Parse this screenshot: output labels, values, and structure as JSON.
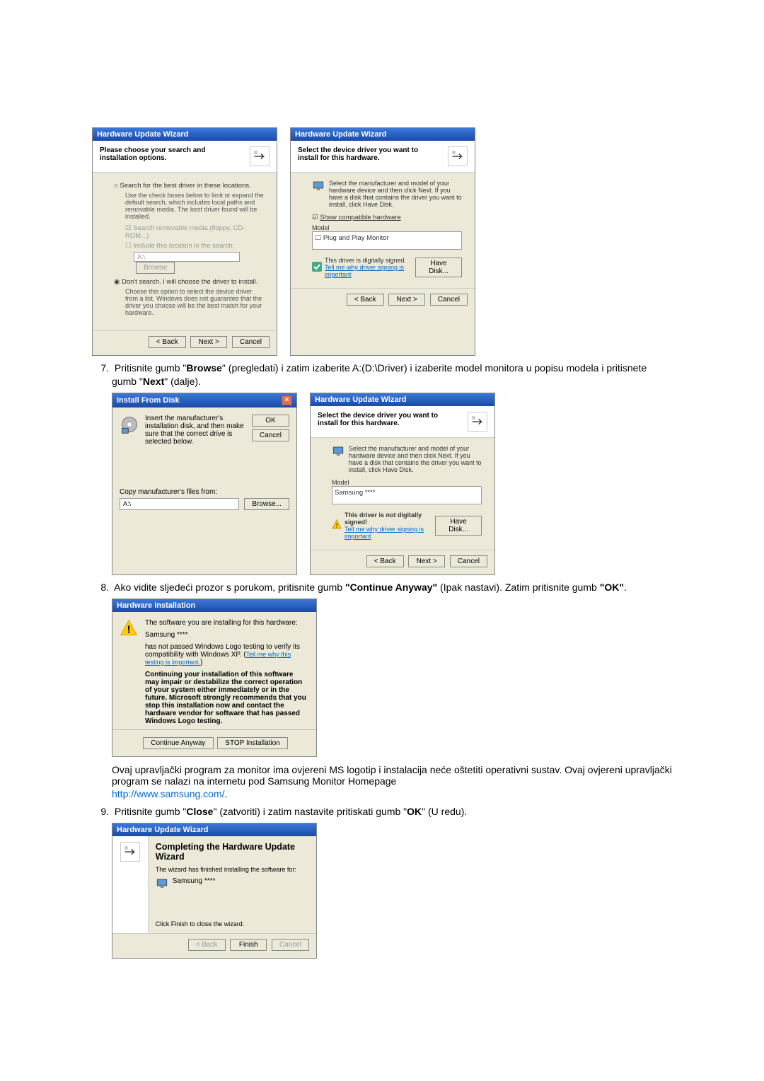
{
  "dialogs": {
    "d1": {
      "title": "Hardware Update Wizard",
      "header": "Please choose your search and installation options.",
      "radio1": "Search for the best driver in these locations.",
      "radio1_sub": "Use the check boxes below to limit or expand the default search, which includes local paths and removable media. The best driver found will be installed.",
      "chk1": "Search removable media (floppy, CD-ROM...)",
      "chk2": "Include this location in the search:",
      "path_value": "A:\\",
      "browse": "Browse",
      "radio2": "Don't search. I will choose the driver to install.",
      "radio2_sub": "Choose this option to select the device driver from a list.  Windows does not guarantee that the driver you choose will be the best match for your hardware.",
      "back": "< Back",
      "next": "Next >",
      "cancel": "Cancel"
    },
    "d2": {
      "title": "Hardware Update Wizard",
      "header": "Select the device driver you want to install for this hardware.",
      "instr": "Select the manufacturer and model of your hardware device and then click Next. If you have a disk that contains the driver you want to install, click Have Disk.",
      "chk_show": "Show compatible hardware",
      "model_label": "Model",
      "model_item": "Plug and Play Monitor",
      "signed": "This driver is digitally signed.",
      "sig_link": "Tell me why driver signing is important",
      "have_disk": "Have Disk...",
      "back": "< Back",
      "next": "Next >",
      "cancel": "Cancel"
    },
    "d3": {
      "title": "Install From Disk",
      "instr": "Insert the manufacturer's installation disk, and then make sure that the correct drive is selected below.",
      "ok": "OK",
      "cancel": "Cancel",
      "copy": "Copy manufacturer's files from:",
      "path": "A:\\",
      "browse": "Browse..."
    },
    "d4": {
      "title": "Hardware Update Wizard",
      "header": "Select the device driver you want to install for this hardware.",
      "instr": "Select the manufacturer and model of your hardware device and then click Next. If you have a disk that contains the driver you want to install, click Have Disk.",
      "model_label": "Model",
      "model_item": "Samsung ****",
      "not_signed": "This driver is not digitally signed!",
      "sig_link": "Tell me why driver signing is important",
      "have_disk": "Have Disk...",
      "back": "< Back",
      "next": "Next >",
      "cancel": "Cancel"
    },
    "d5": {
      "title": "Hardware Installation",
      "line1": "The software you are installing for this hardware:",
      "line2": "Samsung ****",
      "line3": "has not passed Windows Logo testing to verify its compatibility with Windows XP. (",
      "link_test": "Tell me why this testing is important.",
      "line3_end": ")",
      "warn": "Continuing your installation of this software may impair or destabilize the correct operation of your system either immediately or in the future. Microsoft strongly recommends that you stop this installation now and contact the hardware vendor for software that has passed Windows Logo testing.",
      "btn1": "Continue Anyway",
      "btn2": "STOP Installation"
    },
    "d6": {
      "title": "Hardware Update Wizard",
      "heading": "Completing the Hardware Update Wizard",
      "sub": "The wizard has finished installing the software for:",
      "device": "Samsung ****",
      "click_finish": "Click Finish to close the wizard.",
      "back": "< Back",
      "finish": "Finish",
      "cancel": "Cancel"
    }
  },
  "steps": {
    "s7_num": "7.",
    "s7": "Pritisnite gumb \"Browse\" (pregledati) i zatim izaberite A:(D:\\Driver) i izaberite model monitora u popisu modela i pritisnete gumb \"Next\" (dalje).",
    "s8_num": "8.",
    "s8_a": "Ako vidite sljedeći prozor s porukom, pritisnite gumb \"Continue Anyway\" (Ipak nastavi). Zatim pritisnite gumb \"OK\".",
    "para": "Ovaj upravljački program za monitor ima ovjereni MS logotip i instalacija neće oštetiti operativni sustav. Ovaj ovjereni upravljački program se nalazi na internetu pod Samsung Monitor Homepage",
    "url": "http://www.samsung.com/",
    "url_dot": ".",
    "s9_num": "9.",
    "s9": "Pritisnite gumb \"Close\" (zatvoriti) i zatim nastavite pritiskati gumb \"OK\" (U redu)."
  }
}
